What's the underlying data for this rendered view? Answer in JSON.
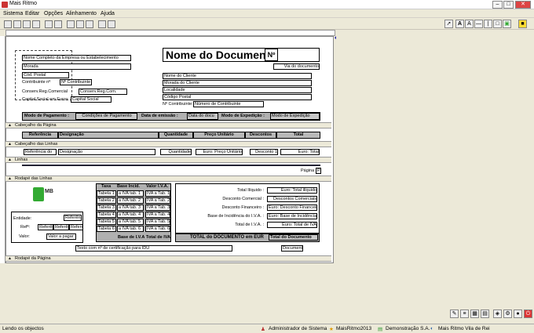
{
  "app": {
    "title": "Mais Ritmo"
  },
  "menu": [
    "Sistema",
    "Editar",
    "Opções",
    "Alinhamento",
    "Ajuda"
  ],
  "doc": {
    "title": "Nome do Documento",
    "numero": "Nº",
    "via": "Via do documento",
    "empresa": "Nome Completo da Empresa ou Estabelecimento",
    "morada": "Morada",
    "cod_postal": "Cód. Postal",
    "contribuinte_label": "Contribuinte nº",
    "contribuinte": "Nº Contribuinte",
    "conserv_label": "Conserv.Reg.Comercial",
    "conserv": "Conserv.Reg.Com.",
    "capital_label": "Capital Social em Euros",
    "capital": "Capital Social",
    "cliente_nome": "Nome do Cliente",
    "cliente_morada": "Morada do Cliente",
    "cliente_localidade": "Localidade",
    "cliente_cp": "Código Postal",
    "cliente_contrib_label": "Nº Contribuinte:",
    "cliente_contrib": "Número de Contribuinte",
    "modo_pag_label": "Modo de Pagamento :",
    "modo_pag": "Condições de Pagamento",
    "data_emissao_label": "Data de emissão :",
    "data_emissao": "Data do docu",
    "modo_exp_label": "Modo de Expedição :",
    "modo_exp": "Modo de Expedição"
  },
  "bands": {
    "cabecalho_pagina": "Cabeçalho da Página",
    "cabecalho_linhas": "Cabeçalho das Linhas",
    "linhas": "Linhas",
    "rodape_linhas": "Rodapé das Linhas",
    "rodape_pagina": "Rodapé da Página"
  },
  "cols": [
    "Referência",
    "Designação",
    "Quantidade",
    "Preço Unitário",
    "Descontos",
    "Total"
  ],
  "row": [
    "Referência do",
    "Designação",
    "Quantidade",
    "Euro: Preço Unitário",
    "Desconto 1",
    "Euro: Total"
  ],
  "pagina": "Página",
  "pagina_field": "Pa",
  "logo_text": "MB",
  "entidade_label": "Entidade:",
  "entidade": "Referên",
  "ref_label": "Refª:",
  "ref_fields": [
    "Referên",
    "Referên",
    "Referên"
  ],
  "valor_label": "Valor:",
  "valor": "Valor a pagar",
  "tax": {
    "headers": [
      "Taxa",
      "Base Incid.",
      "Valor I.V.A."
    ],
    "rows": [
      [
        "Tabela 1",
        "a IVA tab. 1",
        "IVA a Tab. 1"
      ],
      [
        "Tabela 2",
        "a IVA tab. 2",
        "IVA a Tab. 2"
      ],
      [
        "Tabela 3",
        "a IVA tab. 3",
        "IVA a Tab. 3"
      ],
      [
        "Tabela 4",
        "a IVA tab. 4",
        "IVA a Tab. 4"
      ],
      [
        "Tabela 5",
        "a IVA tab. 5",
        "IVA a Tab. 5"
      ],
      [
        "Tabela 6",
        "a IVA tab. 6",
        "IVA a Tab. 6"
      ]
    ],
    "footer": [
      "Base de I.V.A.:",
      "Total de IVA"
    ]
  },
  "totals": [
    {
      "label": "Total Ilíquido :",
      "value": "Euro: Total ilíquido"
    },
    {
      "label": "Desconto Comercial :",
      "value": "Descontos Comerciais"
    },
    {
      "label": "Desconto Financeiro :",
      "value": "Euro: Desconto Financeiro"
    },
    {
      "label": "Base de Incidência do I.V.A. :",
      "value": "Euro: Base de Incidência do I.V.A."
    },
    {
      "label": "Total de I.V.A. :",
      "value": "Euro: Total de IVA"
    }
  ],
  "total_doc_label": "TOTAL do DOCUMENTO em EUR",
  "total_doc": "Total do Documento",
  "cert": "Texto com nº de certificação para IDU",
  "documento": "Documento",
  "status": {
    "left": "Lendo os objectos",
    "user": "Administrador de Sistema",
    "db": "MaisRitmo2013",
    "company": "Demonstração S.A.",
    "app": "Mais Ritmo Vila de Rei"
  }
}
